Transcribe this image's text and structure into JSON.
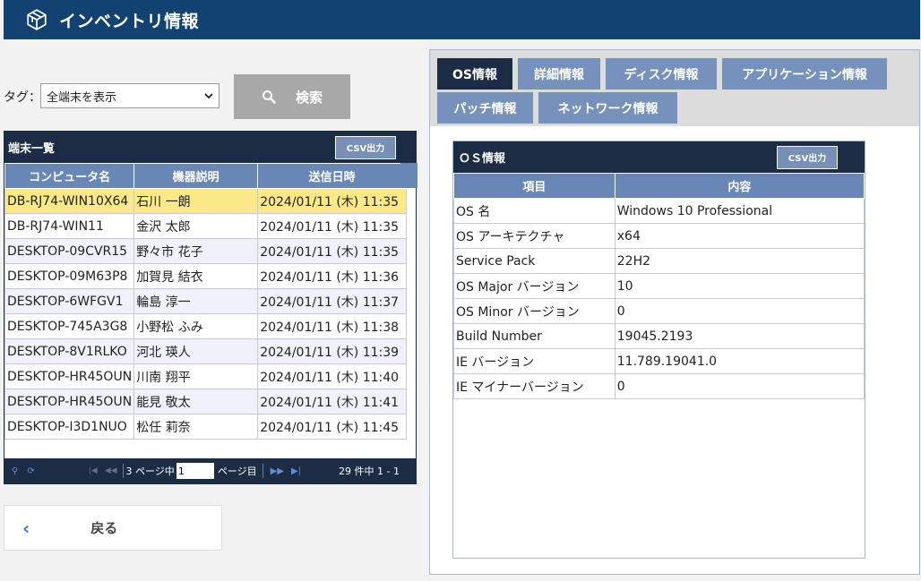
{
  "header": {
    "title": "インベントリ情報",
    "logo_icon": "cube-icon"
  },
  "filter": {
    "tag_label": "タグ：",
    "tag_selected": "全端末を表示",
    "search_label": "検索"
  },
  "device_list": {
    "title": "端末一覧",
    "csv_label": "CSV出力",
    "columns": [
      "コンピュータ名",
      "機器説明",
      "送信日時"
    ],
    "rows": [
      {
        "name": "DB-RJ74-WIN10X64",
        "desc": "石川 一朗",
        "sent": "2024/01/11 (木) 11:35"
      },
      {
        "name": "DB-RJ74-WIN11",
        "desc": "金沢 太郎",
        "sent": "2024/01/11 (木) 11:35"
      },
      {
        "name": "DESKTOP-09CVR15",
        "desc": "野々市 花子",
        "sent": "2024/01/11 (木) 11:35"
      },
      {
        "name": "DESKTOP-09M63P8",
        "desc": "加賀見 結衣",
        "sent": "2024/01/11 (木) 11:36"
      },
      {
        "name": "DESKTOP-6WFGV1",
        "desc": "輪島 淳一",
        "sent": "2024/01/11 (木) 11:37"
      },
      {
        "name": "DESKTOP-745A3G8",
        "desc": "小野松 ふみ",
        "sent": "2024/01/11 (木) 11:38"
      },
      {
        "name": "DESKTOP-8V1RLKO",
        "desc": "河北 瑛人",
        "sent": "2024/01/11 (木) 11:39"
      },
      {
        "name": "DESKTOP-HR45OUN",
        "desc": "川南 翔平",
        "sent": "2024/01/11 (木) 11:40"
      },
      {
        "name": "DESKTOP-HR45OUN",
        "desc": "能見 敬太",
        "sent": "2024/01/11 (木) 11:41"
      },
      {
        "name": "DESKTOP-I3D1NUO",
        "desc": "松任 莉奈",
        "sent": "2024/01/11 (木) 11:45"
      }
    ],
    "selected_index": 0,
    "pager": {
      "pages_text": "3 ページ中",
      "page_value": "1",
      "page_suffix": "ページ目",
      "count_text": "29 件中 1 - 1"
    }
  },
  "back_label": "戻る",
  "tabs": [
    {
      "label": "OS情報",
      "active": true
    },
    {
      "label": "詳細情報",
      "active": false
    },
    {
      "label": "ディスク情報",
      "active": false
    },
    {
      "label": "アプリケーション情報",
      "active": false
    },
    {
      "label": "パッチ情報",
      "active": false
    },
    {
      "label": "ネットワーク情報",
      "active": false
    }
  ],
  "os_info": {
    "title": "ＯＳ情報",
    "csv_label": "CSV出力",
    "columns": [
      "項目",
      "内容"
    ],
    "rows": [
      {
        "key": "OS 名",
        "value": "Windows 10 Professional"
      },
      {
        "key": "OS アーキテクチャ",
        "value": "x64"
      },
      {
        "key": "Service Pack",
        "value": "22H2"
      },
      {
        "key": "OS Major バージョン",
        "value": "10"
      },
      {
        "key": "OS Minor バージョン",
        "value": "0"
      },
      {
        "key": "Build Number",
        "value": "19045.2193"
      },
      {
        "key": "IE バージョン",
        "value": "11.789.19041.0"
      },
      {
        "key": "IE マイナーバージョン",
        "value": "0"
      }
    ]
  },
  "colors": {
    "header_bg": "#124272",
    "panel_dark": "#1b2c44",
    "table_header": "#6886b6",
    "tab_inactive": "#7691bb",
    "selected_row": "#fbe886"
  }
}
